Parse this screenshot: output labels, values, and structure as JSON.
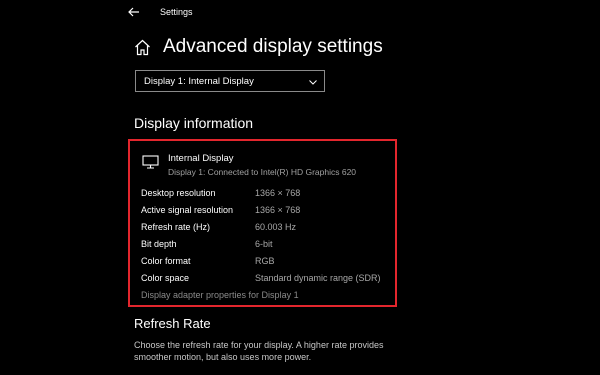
{
  "window": {
    "title": "Settings"
  },
  "header": {
    "title": "Advanced display settings"
  },
  "display_select": {
    "selected": "Display 1: Internal Display"
  },
  "display_info": {
    "section_title": "Display information",
    "display_name": "Internal Display",
    "display_subtitle": "Display 1: Connected to Intel(R) HD Graphics 620",
    "properties": [
      {
        "label": "Desktop resolution",
        "value": "1366 × 768"
      },
      {
        "label": "Active signal resolution",
        "value": "1366 × 768"
      },
      {
        "label": "Refresh rate (Hz)",
        "value": "60.003 Hz"
      },
      {
        "label": "Bit depth",
        "value": "6-bit"
      },
      {
        "label": "Color format",
        "value": "RGB"
      },
      {
        "label": "Color space",
        "value": "Standard dynamic range (SDR)"
      }
    ],
    "adapter_link": "Display adapter properties for Display 1"
  },
  "refresh_rate": {
    "title": "Refresh Rate",
    "description": "Choose the refresh rate for your display. A higher rate provides smoother motion, but also uses more power."
  },
  "colors": {
    "highlight_border": "#e3262d",
    "background": "#000000"
  },
  "icons": [
    "back-arrow-icon",
    "home-icon",
    "chevron-down-icon",
    "monitor-icon"
  ]
}
